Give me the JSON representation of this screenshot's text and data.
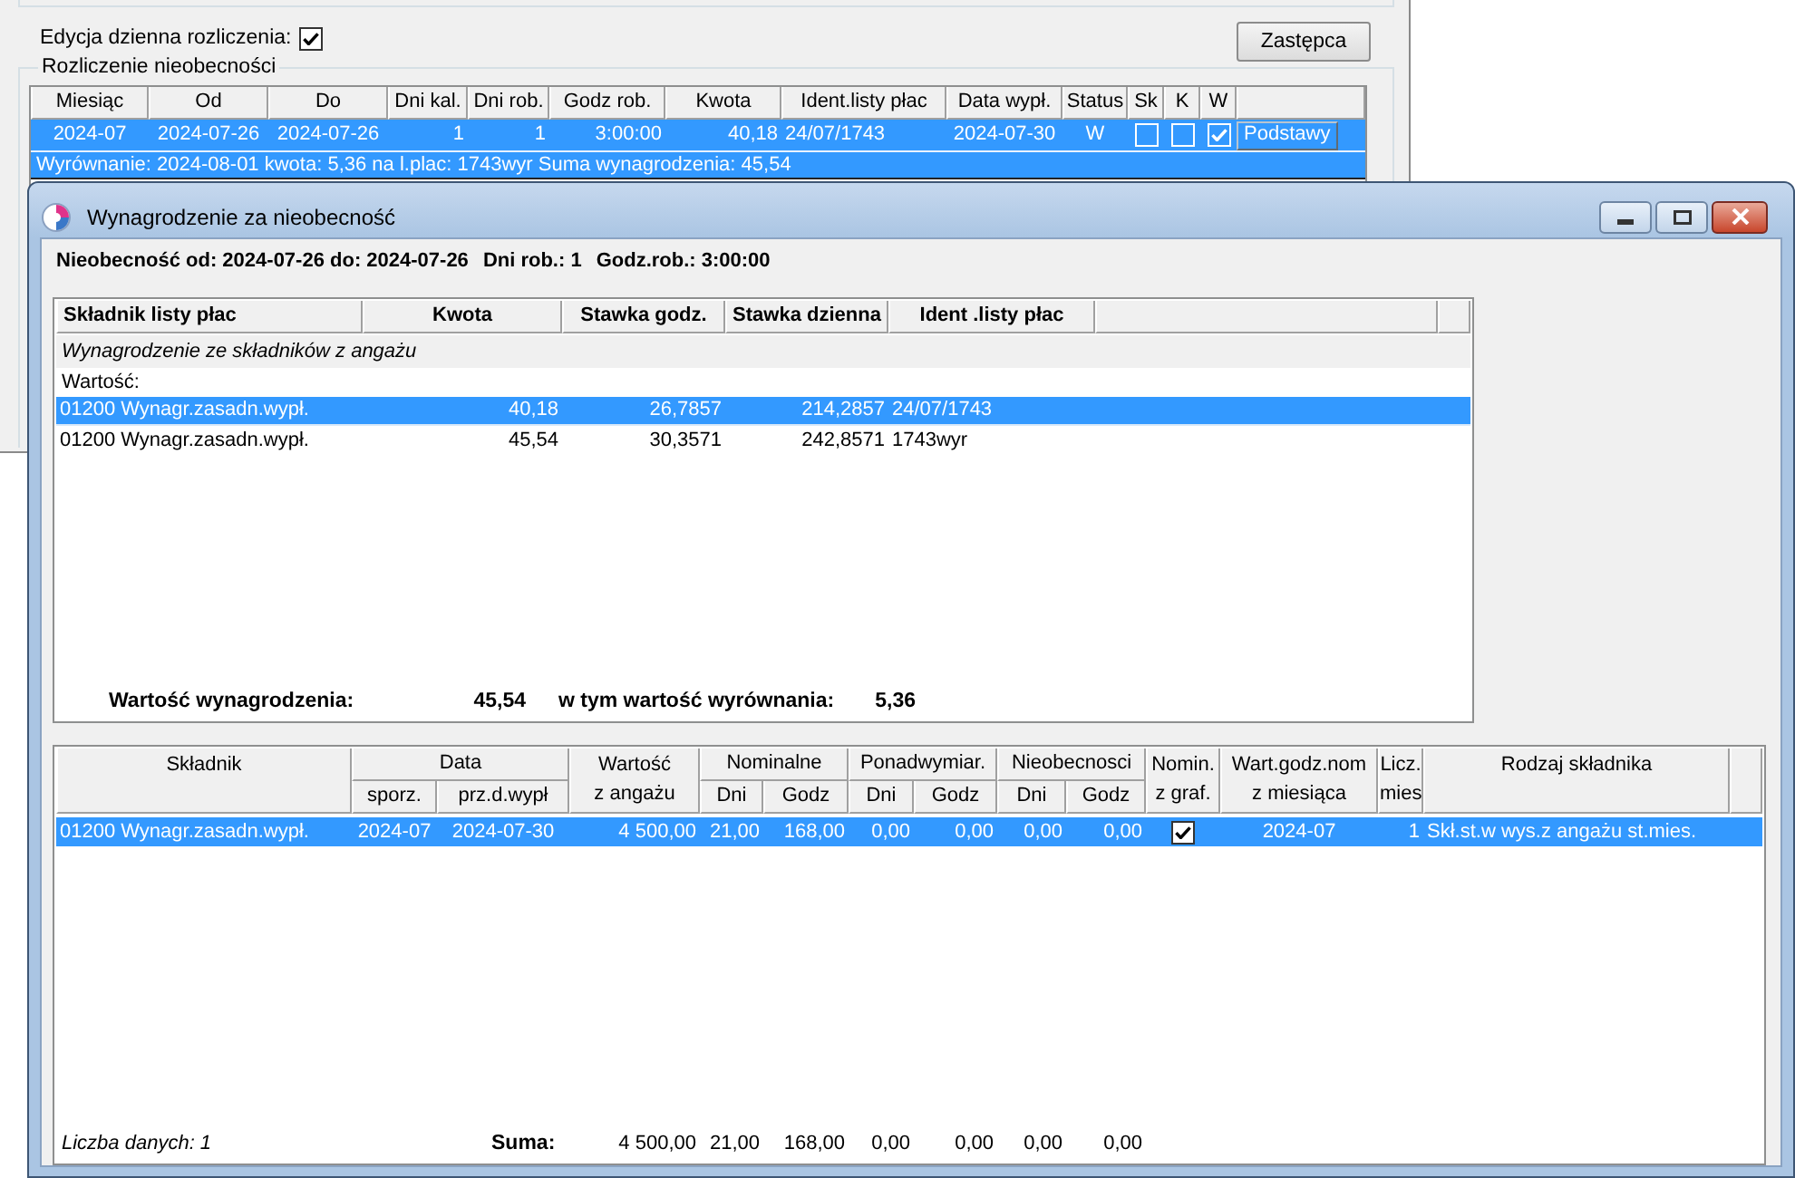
{
  "background_window": {
    "daily_edit": {
      "label": "Edycja dzienna rozliczenia:",
      "checked": true
    },
    "substitute_button": "Zastępca",
    "group_title": "Rozliczenie nieobecności",
    "table": {
      "columns": [
        "Miesiąc",
        "Od",
        "Do",
        "Dni kal.",
        "Dni rob.",
        "Godz rob.",
        "Kwota",
        "Ident.listy płac",
        "Data wypł.",
        "Status",
        "Sk",
        "K",
        "W"
      ],
      "rows": [
        {
          "selected": true,
          "cells": [
            "2024-07",
            "2024-07-26",
            "2024-07-26",
            "1",
            "1",
            "3:00:00",
            "40,18",
            "24/07/1743",
            "2024-07-30",
            "W"
          ],
          "sk": false,
          "k": false,
          "w": true,
          "button": "Podstawy",
          "note": "Wyrównanie: 2024-08-01 kwota: 5,36 na l.plac: 1743wyr Suma wynagrodzenia: 45,54"
        }
      ]
    }
  },
  "dialog": {
    "title": "Wynagrodzenie za nieobecność",
    "summary_line": [
      "Nieobecność od: 2024-07-26 do: 2024-07-26",
      "Dni rob.: 1",
      "Godz.rob.: 3:00:00"
    ],
    "components_table": {
      "columns": [
        "Składnik listy płac",
        "Kwota",
        "Stawka godz.",
        "Stawka dzienna",
        "Ident .listy płac"
      ],
      "group": "Wynagrodzenie ze składników z angażu",
      "subgroup": "Wartość:",
      "rows": [
        {
          "selected": true,
          "cells": [
            "01200 Wynagr.zasadn.wypł.",
            "40,18",
            "26,7857",
            "214,2857",
            "24/07/1743"
          ]
        },
        {
          "selected": false,
          "cells": [
            "01200 Wynagr.zasadn.wypł.",
            "45,54",
            "30,3571",
            "242,8571",
            "1743wyr"
          ]
        }
      ],
      "totals": [
        {
          "label": "Wartość wynagrodzenia:",
          "value": "45,54"
        },
        {
          "label": "w tym wartość wyrównania:",
          "value": "5,36"
        }
      ]
    },
    "details_table": {
      "columns": [
        {
          "label": [
            "Składnik"
          ]
        },
        {
          "label": [
            "Data"
          ],
          "sub": [
            "sporz.",
            "prz.d.wypł"
          ]
        },
        {
          "label": [
            "Wartość",
            "z angażu"
          ]
        },
        {
          "label": [
            "Nominalne"
          ],
          "sub": [
            "Dni",
            "Godz"
          ]
        },
        {
          "label": [
            "Ponadwymiar."
          ],
          "sub": [
            "Dni",
            "Godz"
          ]
        },
        {
          "label": [
            "Nieobecnosci"
          ],
          "sub": [
            "Dni",
            "Godz"
          ]
        },
        {
          "label": [
            "Nomin.",
            "z graf."
          ]
        },
        {
          "label": [
            "Wart.godz.nom",
            "z miesiąca"
          ]
        },
        {
          "label": [
            "Licz.",
            "mies"
          ]
        },
        {
          "label": [
            "Rodzaj składnika"
          ]
        }
      ],
      "rows": [
        {
          "selected": true,
          "cells": [
            {
              "kind": "text",
              "text": "01200 Wynagr.zasadn.wypł."
            },
            {
              "kind": "pair",
              "values": [
                "2024-07",
                "2024-07-30"
              ]
            },
            {
              "kind": "text",
              "text": "4 500,00"
            },
            {
              "kind": "pair",
              "values": [
                "21,00",
                "168,00"
              ]
            },
            {
              "kind": "pair",
              "values": [
                "0,00",
                "0,00"
              ]
            },
            {
              "kind": "pair",
              "values": [
                "0,00",
                "0,00"
              ]
            },
            {
              "kind": "checkbox",
              "checked": true
            },
            {
              "kind": "text",
              "text": "2024-07"
            },
            {
              "kind": "text",
              "text": "1"
            },
            {
              "kind": "text",
              "text": "Skł.st.w wys.z angażu st.mies."
            }
          ]
        }
      ],
      "footer": {
        "count": "Liczba danych: 1",
        "sum_label": "Suma:",
        "sums": [
          "4 500,00",
          "21,00",
          "168,00",
          "0,00",
          "0,00",
          "0,00",
          "0,00"
        ]
      }
    }
  }
}
